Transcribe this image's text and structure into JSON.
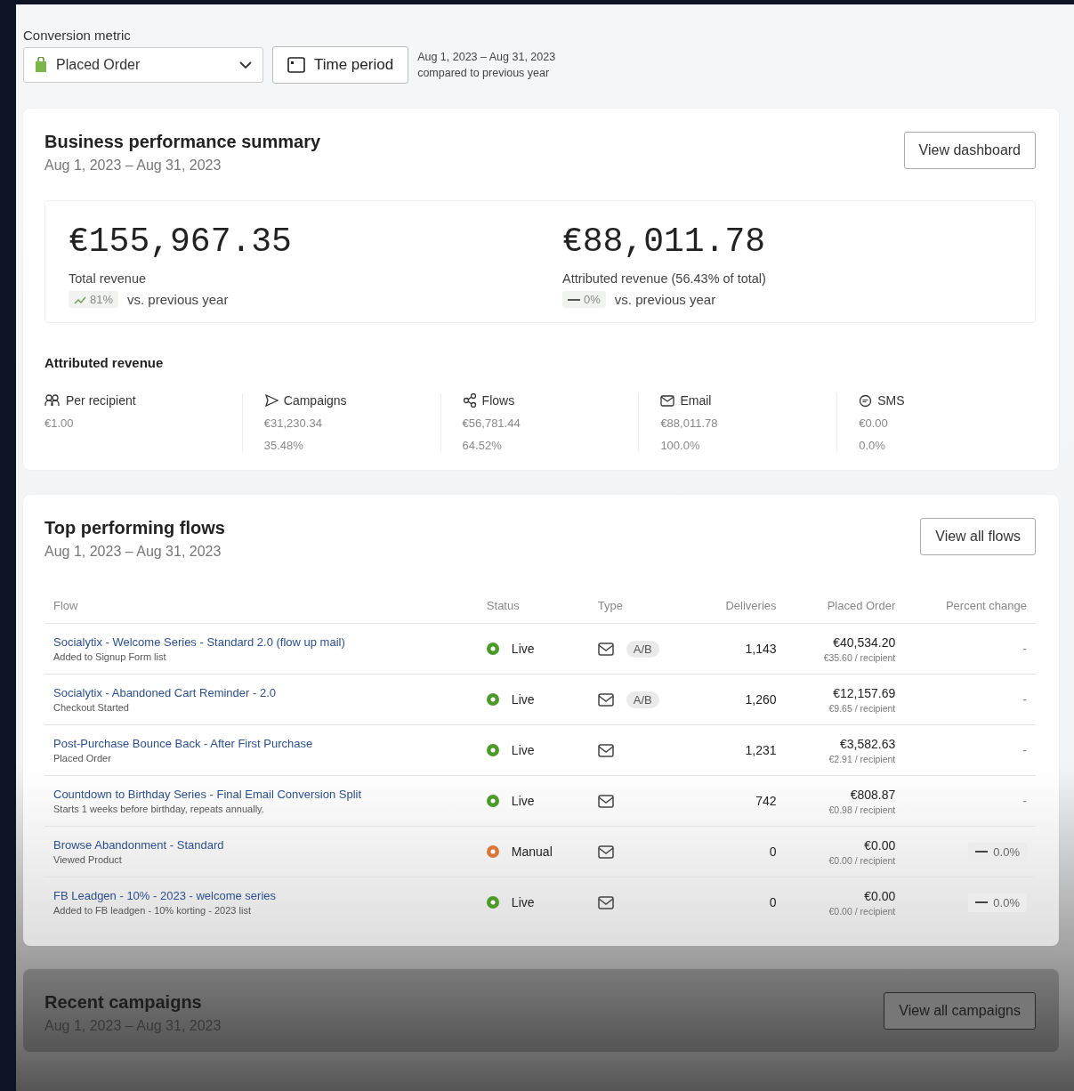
{
  "filters": {
    "label": "Conversion metric",
    "metric": "Placed Order",
    "time_button": "Time period",
    "range": "Aug 1, 2023 – Aug 31, 2023",
    "comparison": "compared to previous year"
  },
  "summary": {
    "title": "Business performance summary",
    "dates": "Aug 1, 2023 – Aug 31, 2023",
    "button": "View dashboard",
    "totals": [
      {
        "value": "€155,967.35",
        "label": "Total revenue",
        "kind": "up",
        "change": "81%",
        "compare": "vs. previous year"
      },
      {
        "value": "€88,011.78",
        "label": "Attributed revenue (56.43% of total)",
        "kind": "flat",
        "change": "0%",
        "compare": "vs. previous year"
      }
    ],
    "attributed_title": "Attributed revenue",
    "attributed": [
      {
        "kind": "people",
        "label": "Per recipient",
        "value": "€1.00"
      },
      {
        "kind": "campaign",
        "label": "Campaigns",
        "value": "€31,230.34",
        "share": "35.48%"
      },
      {
        "kind": "flow",
        "label": "Flows",
        "value": "€56,781.44",
        "share": "64.52%"
      },
      {
        "kind": "email",
        "label": "Email",
        "value": "€88,011.78",
        "share": "100.0%"
      },
      {
        "kind": "sms",
        "label": "SMS",
        "value": "€0.00",
        "share": "0.0%"
      }
    ]
  },
  "flows": {
    "title": "Top performing flows",
    "dates": "Aug 1, 2023 – Aug 31, 2023",
    "button": "View all flows",
    "columns": [
      "Flow",
      "Status",
      "Type",
      "Deliveries",
      "Placed Order",
      "Percent change"
    ],
    "rows": [
      {
        "name": "Socialytix - Welcome Series - Standard 2.0 (flow up mail)",
        "trigger": "Added to Signup Form list",
        "status": "Live",
        "color": "#4c9a2a",
        "ab": "A/B",
        "deliveries": "1,143",
        "revenue": "€40,534.20",
        "per_recipient": "€35.60 / recipient",
        "change": "-",
        "kind": "plain"
      },
      {
        "name": "Socialytix - Abandoned Cart Reminder - 2.0",
        "trigger": "Checkout Started",
        "status": "Live",
        "color": "#4c9a2a",
        "ab": "A/B",
        "deliveries": "1,260",
        "revenue": "€12,157.69",
        "per_recipient": "€9.65 / recipient",
        "change": "-",
        "kind": "plain"
      },
      {
        "name": "Post-Purchase Bounce Back - After First Purchase",
        "trigger": "Placed Order",
        "status": "Live",
        "color": "#4c9a2a",
        "deliveries": "1,231",
        "revenue": "€3,582.63",
        "per_recipient": "€2.91 / recipient",
        "change": "-",
        "kind": "plain"
      },
      {
        "name": "Countdown to Birthday Series - Final Email Conversion Split",
        "trigger": "Starts 1 weeks before birthday, repeats annually.",
        "status": "Live",
        "color": "#4c9a2a",
        "deliveries": "742",
        "revenue": "€808.87",
        "per_recipient": "€0.98 / recipient",
        "change": "-",
        "kind": "plain"
      },
      {
        "name": "Browse Abandonment - Standard",
        "trigger": "Viewed Product",
        "status": "Manual",
        "color": "#d9773b",
        "deliveries": "0",
        "revenue": "€0.00",
        "per_recipient": "€0.00 / recipient",
        "change": "0.0%",
        "kind": "flat"
      },
      {
        "name": "FB Leadgen - 10% - 2023 - welcome series",
        "trigger": "Added to FB leadgen - 10% korting - 2023 list",
        "status": "Live",
        "color": "#4c9a2a",
        "deliveries": "0",
        "revenue": "€0.00",
        "per_recipient": "€0.00 / recipient",
        "change": "0.0%",
        "kind": "flat"
      }
    ]
  },
  "campaigns": {
    "title": "Recent campaigns",
    "dates": "Aug 1, 2023 – Aug 31, 2023",
    "button": "View all campaigns"
  }
}
